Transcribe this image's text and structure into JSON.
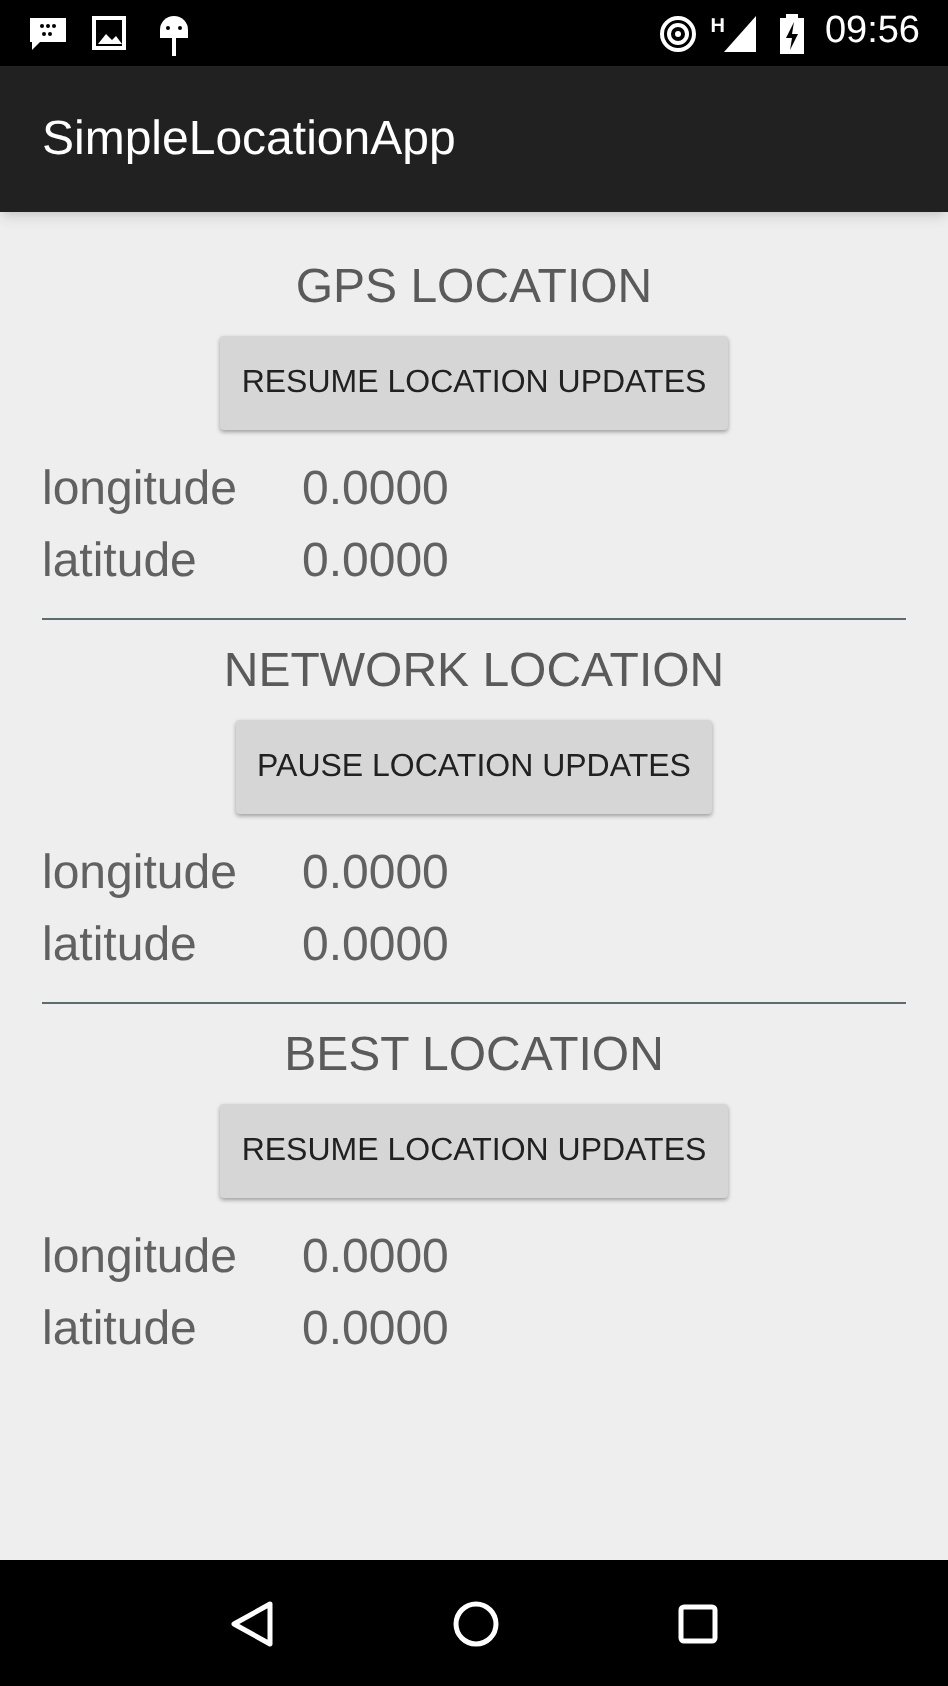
{
  "status_bar": {
    "network_type": "H",
    "time": "09:56"
  },
  "app_bar": {
    "title": "SimpleLocationApp"
  },
  "sections": [
    {
      "heading": "GPS LOCATION",
      "button": "RESUME LOCATION UPDATES",
      "rows": [
        {
          "label": "longitude",
          "value": "0.0000"
        },
        {
          "label": "latitude",
          "value": "0.0000"
        }
      ]
    },
    {
      "heading": "NETWORK LOCATION",
      "button": "PAUSE LOCATION UPDATES",
      "rows": [
        {
          "label": "longitude",
          "value": "0.0000"
        },
        {
          "label": "latitude",
          "value": "0.0000"
        }
      ]
    },
    {
      "heading": "BEST LOCATION",
      "button": "RESUME LOCATION UPDATES",
      "rows": [
        {
          "label": "longitude",
          "value": "0.0000"
        },
        {
          "label": "latitude",
          "value": "0.0000"
        }
      ]
    }
  ]
}
